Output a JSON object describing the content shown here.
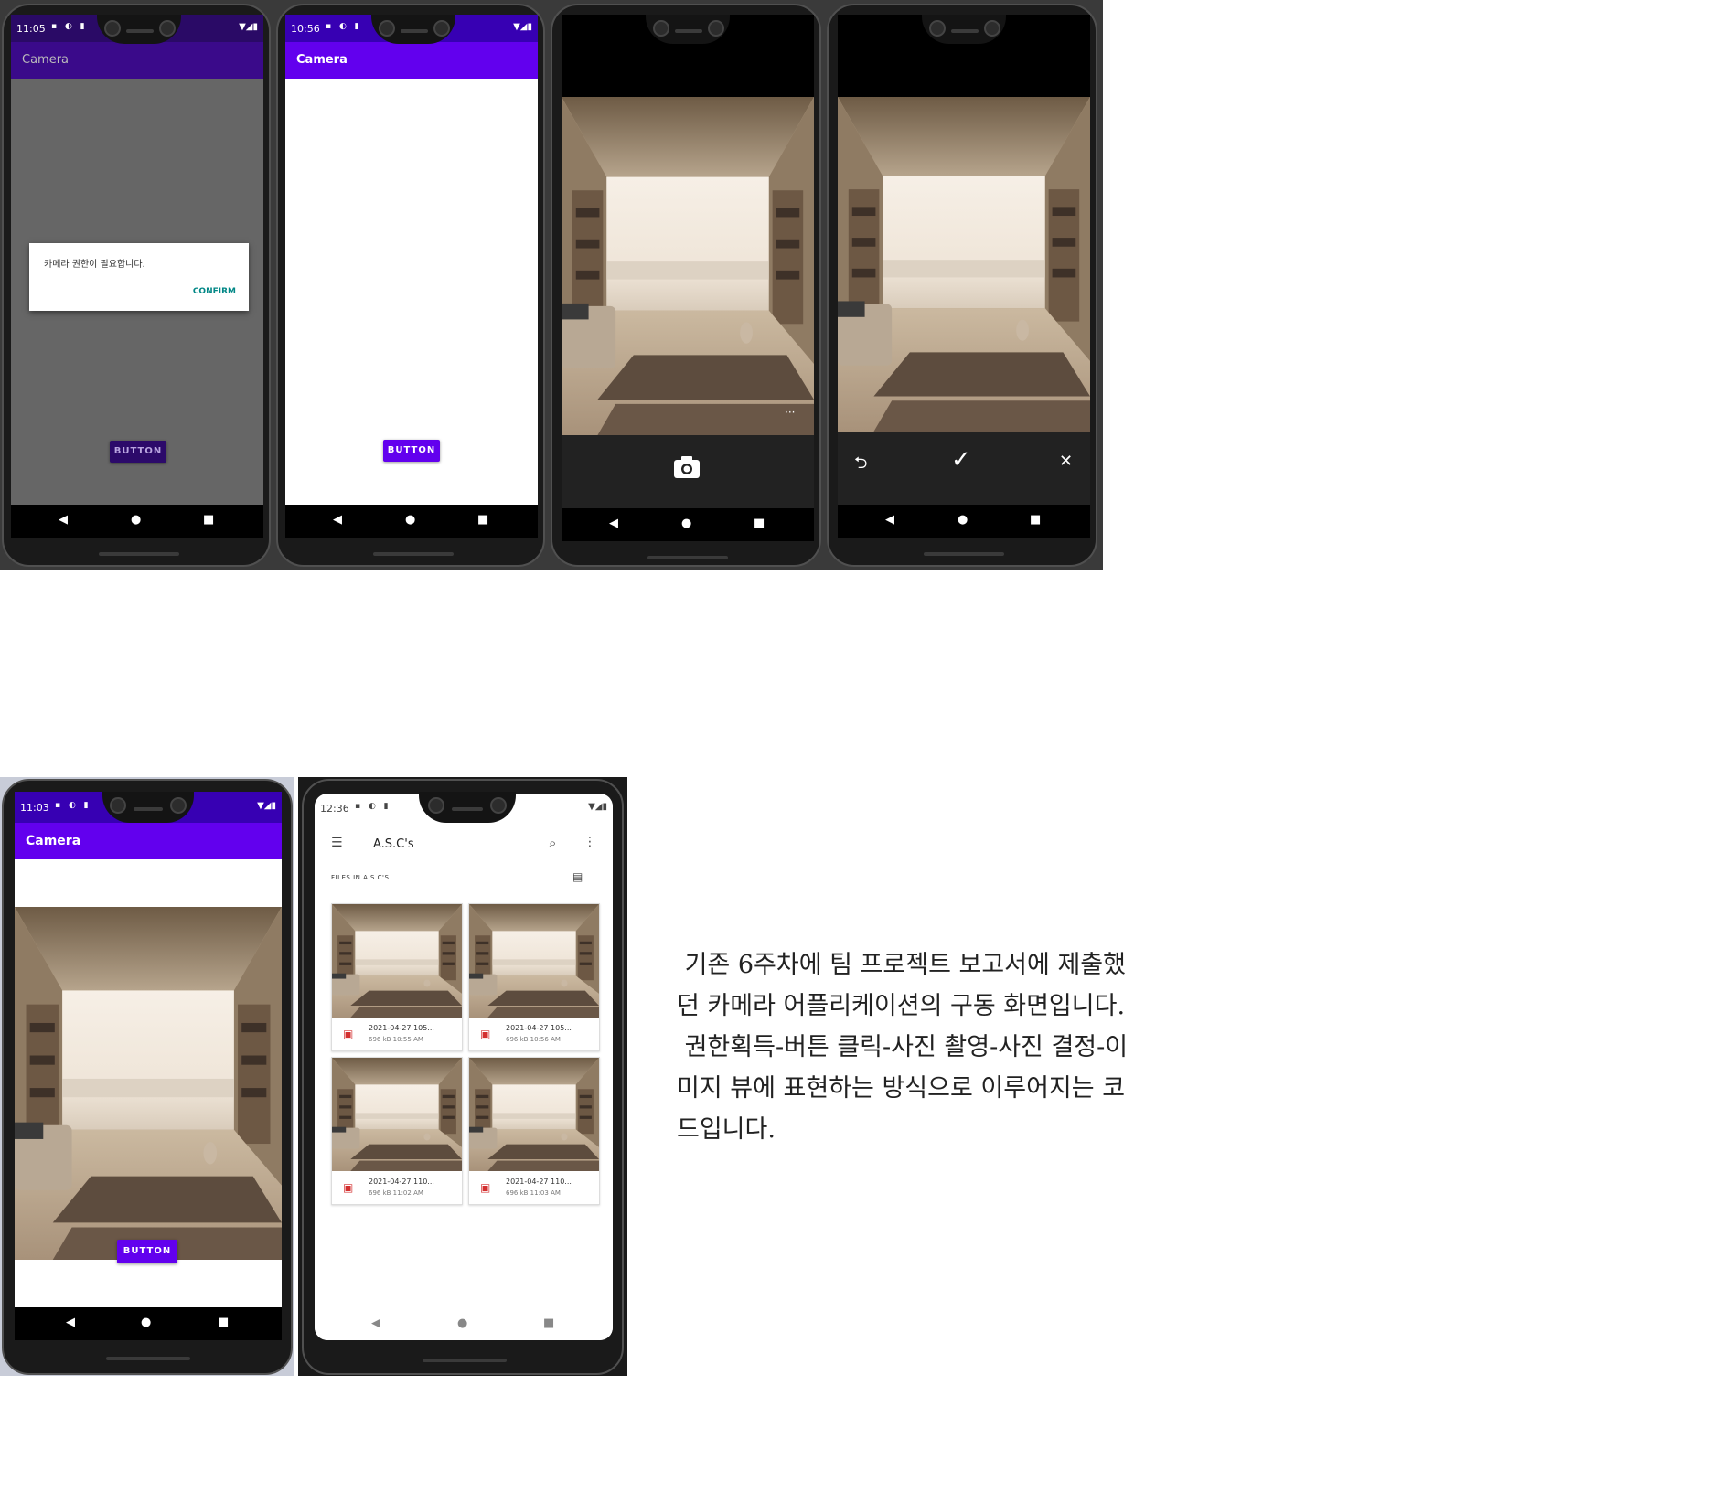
{
  "phones": {
    "p1": {
      "time": "11:05",
      "app_title": "Camera",
      "dialog_message": "카메라 권한이 필요합니다.",
      "dialog_confirm": "CONFIRM",
      "button": "BUTTON"
    },
    "p2": {
      "time": "10:56",
      "app_title": "Camera",
      "button": "BUTTON"
    },
    "p5": {
      "time": "11:03",
      "app_title": "Camera",
      "button": "BUTTON"
    },
    "p6": {
      "time": "12:36",
      "app_title": "A.S.C's",
      "section_label": "FILES IN A.S.C'S",
      "files": [
        {
          "name": "2021-04-27 105...",
          "meta": "696 kB 10:55 AM"
        },
        {
          "name": "2021-04-27 105...",
          "meta": "696 kB 10:56 AM"
        },
        {
          "name": "2021-04-27 110...",
          "meta": "696 kB 11:02 AM"
        },
        {
          "name": "2021-04-27 110...",
          "meta": "696 kB 11:03 AM"
        }
      ]
    }
  },
  "icons": {
    "back": "◀",
    "home": "●",
    "recents": "■",
    "camera": "camera-icon",
    "retake": "⮌",
    "confirm": "✓",
    "close": "✕",
    "menu": "☰",
    "search": "⌕",
    "more": "⋮",
    "grid": "▤",
    "image": "▣"
  },
  "colors": {
    "primary": "#6200ee",
    "primary_dark": "#3700b3",
    "accent": "#018786"
  },
  "report": {
    "paragraph1": " 기존 6주차에 팀 프로젝트 보고서에 제출했던 카메라 어플리케이션의 구동 화면입니다.",
    "paragraph2": " 권한획득-버튼 클릭-사진 촬영-사진 결정-이미지 뷰에 표현하는 방식으로 이루어지는 코드입니다."
  }
}
